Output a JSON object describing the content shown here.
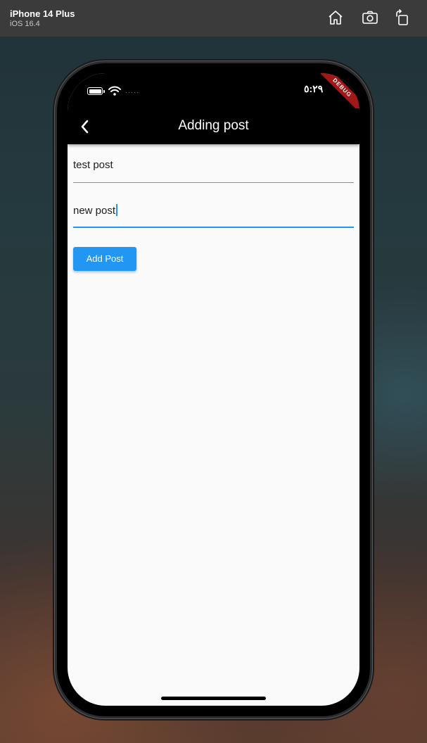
{
  "simulator": {
    "device": "iPhone 14 Plus",
    "os": "iOS 16.4",
    "toolbar_icons": [
      "home-icon",
      "screenshot-icon",
      "rotate-icon"
    ]
  },
  "status_bar": {
    "time": "٥:٢٩",
    "signal_dots": "·····",
    "icons": [
      "battery-icon",
      "wifi-icon"
    ]
  },
  "debug_banner": "DEBUG",
  "app_bar": {
    "title": "Adding post",
    "back_icon": "chevron-left-icon"
  },
  "form": {
    "title_field_value": "test post",
    "body_field_value": "new post",
    "submit_label": "Add Post"
  },
  "colors": {
    "accent": "#2196f3",
    "app_bar": "#000000",
    "background": "#fafafa",
    "debug": "#a01818"
  }
}
